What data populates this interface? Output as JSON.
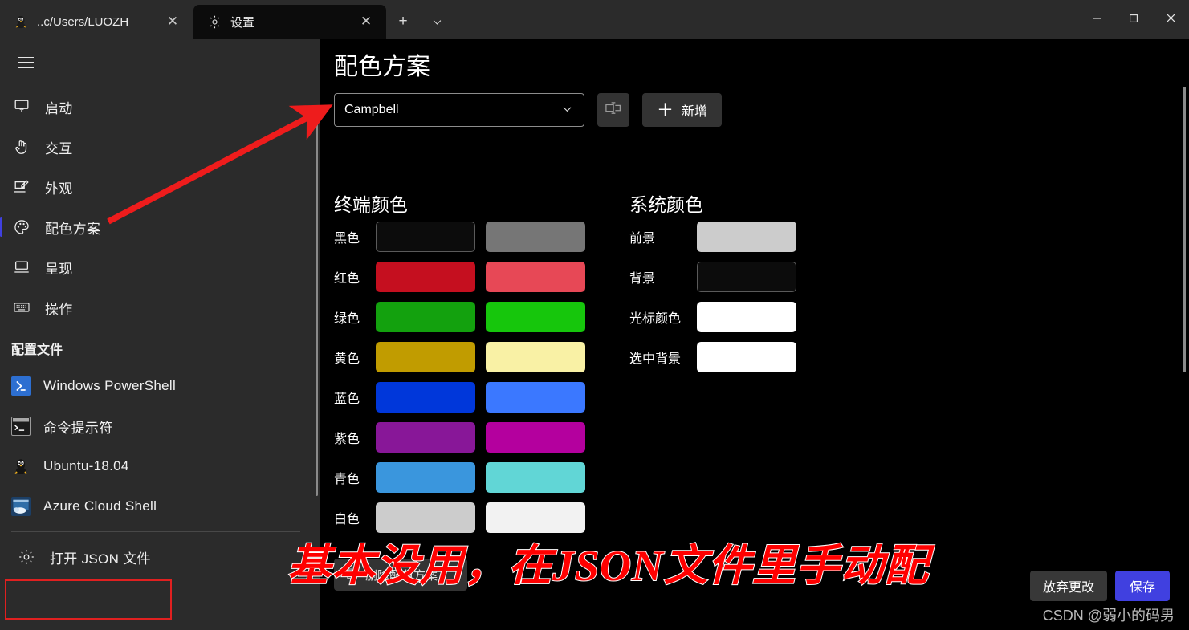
{
  "window": {
    "controls": [
      {
        "name": "minimize",
        "glyph": "—"
      },
      {
        "name": "maximize",
        "glyph": "□"
      },
      {
        "name": "close",
        "glyph": "✕"
      }
    ]
  },
  "tabs": [
    {
      "title": "..c/Users/LUOZH",
      "icon": "linux-penguin-icon",
      "active": false,
      "close": "✕"
    },
    {
      "title": "设置",
      "icon": "gear-icon",
      "active": true,
      "close": "✕"
    }
  ],
  "tabbar": {
    "new_tab": "+",
    "dropdown": "⌄"
  },
  "sidebar": {
    "hamburger_label": "菜单",
    "items": [
      {
        "label": "启动",
        "icon": "startup-icon",
        "selected": false
      },
      {
        "label": "交互",
        "icon": "interaction-hand-icon",
        "selected": false
      },
      {
        "label": "外观",
        "icon": "appearance-icon",
        "selected": false
      },
      {
        "label": "配色方案",
        "icon": "color-palette-icon",
        "selected": true
      },
      {
        "label": "呈现",
        "icon": "rendering-icon",
        "selected": false
      },
      {
        "label": "操作",
        "icon": "keyboard-actions-icon",
        "selected": false
      }
    ],
    "section_title": "配置文件",
    "profiles": [
      {
        "label": "Windows PowerShell",
        "icon": "powershell-icon"
      },
      {
        "label": "命令提示符",
        "icon": "command-prompt-icon"
      },
      {
        "label": "Ubuntu-18.04",
        "icon": "ubuntu-penguin-icon"
      },
      {
        "label": "Azure Cloud Shell",
        "icon": "azure-cloud-shell-icon"
      }
    ],
    "open_json": {
      "label": "打开 JSON 文件",
      "icon": "gear-icon"
    }
  },
  "main": {
    "page_title": "配色方案",
    "scheme_select": {
      "value": "Campbell",
      "chevron": "⌄"
    },
    "rename_button_label": "重命名",
    "add_button": {
      "plus": "＋",
      "label": "新增"
    },
    "terminal_colors": {
      "heading": "终端颜色",
      "rows": [
        {
          "label": "黑色",
          "normal": "#0C0C0C",
          "bright": "#767676"
        },
        {
          "label": "红色",
          "normal": "#C50F1F",
          "bright": "#E74856"
        },
        {
          "label": "绿色",
          "normal": "#13A10E",
          "bright": "#16C60C"
        },
        {
          "label": "黄色",
          "normal": "#C19C00",
          "bright": "#F9F1A5"
        },
        {
          "label": "蓝色",
          "normal": "#0037DA",
          "bright": "#3B78FF"
        },
        {
          "label": "紫色",
          "normal": "#881798",
          "bright": "#B4009E"
        },
        {
          "label": "青色",
          "normal": "#3A96DD",
          "bright": "#61D6D6"
        },
        {
          "label": "白色",
          "normal": "#CCCCCC",
          "bright": "#F2F2F2"
        }
      ]
    },
    "system_colors": {
      "heading": "系统颜色",
      "rows": [
        {
          "label": "前景",
          "color": "#CCCCCC"
        },
        {
          "label": "背景",
          "color": "#0C0C0C"
        },
        {
          "label": "光标颜色",
          "color": "#FFFFFF"
        },
        {
          "label": "选中背景",
          "color": "#FFFFFF"
        }
      ]
    },
    "delete_button": "删除配色方案",
    "discard_button": "放弃更改",
    "save_button": "保存",
    "watermark": "CSDN @弱小的码男"
  },
  "annotations": {
    "red_text": "基本没用，在JSON文件里手动配",
    "arrow_color": "#EE1C1C",
    "highlight_box_color": "#E02020"
  },
  "colors": {
    "accent": "#4040E0",
    "titlebar_bg": "#2B2B2B",
    "content_bg": "#000000",
    "sidebar_bg": "#2B2B2B"
  }
}
